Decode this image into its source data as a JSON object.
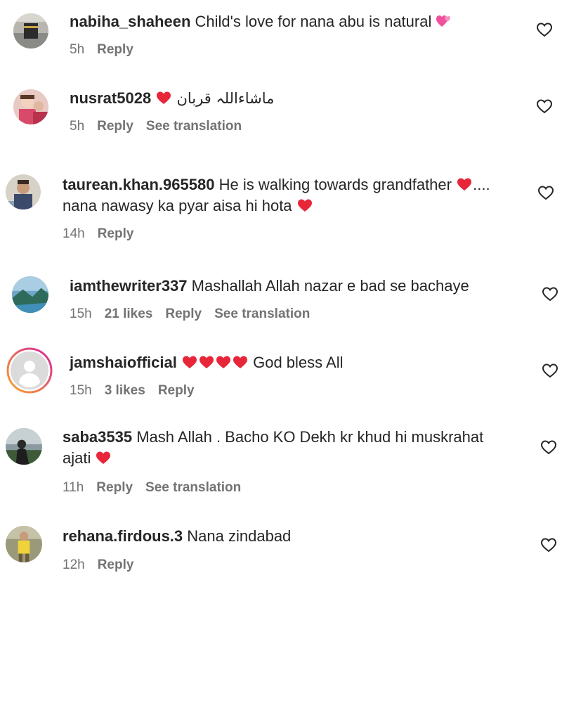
{
  "comments": [
    {
      "username": "nabiha_shaheen",
      "text": "Child's love for nana abu is natural",
      "time": "5h",
      "reply": "Reply",
      "emoji": "two-hearts-icon"
    },
    {
      "username": "nusrat5028",
      "text": "ماشاءاللہ قربان",
      "time": "5h",
      "reply": "Reply",
      "translate": "See translation",
      "emoji": "red-heart-icon"
    },
    {
      "username": "taurean.khan.965580",
      "text": "He is walking towards grandfather",
      "text_after": "....",
      "text_line2": "nana nawasy ka pyar aisa hi hota",
      "time": "14h",
      "reply": "Reply",
      "emoji": "red-heart-icon"
    },
    {
      "username": "iamthewriter337",
      "text": "Mashallah Allah nazar e bad se bachaye",
      "time": "15h",
      "likes": "21 likes",
      "reply": "Reply",
      "translate": "See translation"
    },
    {
      "username": "jamshaiofficial",
      "text": "God bless All",
      "time": "15h",
      "likes": "3 likes",
      "reply": "Reply",
      "emoji": "red-heart-icon"
    },
    {
      "username": "saba3535",
      "text": "Mash Allah . Bacho KO Dekh kr khud hi muskrahat",
      "text_line2": "ajati",
      "time": "11h",
      "reply": "Reply",
      "translate": "See translation",
      "emoji": "red-heart-icon"
    },
    {
      "username": "rehana.firdous.3",
      "text": "Nana zindabad",
      "time": "12h",
      "reply": "Reply"
    }
  ],
  "colors": {
    "text": "#262626",
    "meta": "#737373",
    "heart": "#e8263a",
    "pink_heart": "#f0509c",
    "story_ring_start": "#f9a825",
    "story_ring_end": "#d6249f"
  }
}
